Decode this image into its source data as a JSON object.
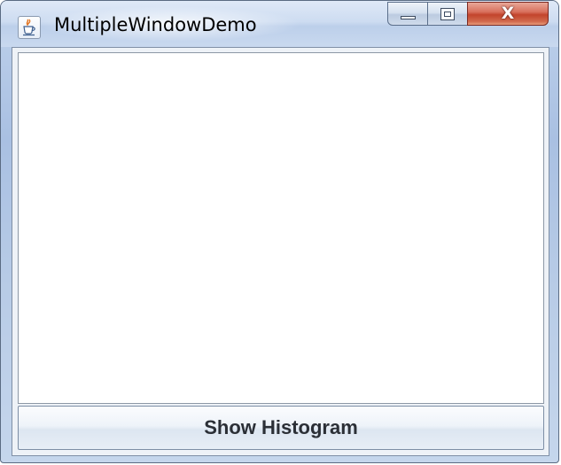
{
  "window": {
    "title": "MultipleWindowDemo",
    "icon": "java-coffee-cup-icon"
  },
  "caption_buttons": {
    "minimize_icon": "minimize-icon",
    "maximize_icon": "maximize-icon",
    "close_icon": "close-icon",
    "close_glyph": "X"
  },
  "main": {
    "histogram_button_label": "Show Histogram"
  },
  "colors": {
    "close_button": "#c94a30",
    "title_bar": "#c9d9ef",
    "content_background": "#ffffff"
  }
}
